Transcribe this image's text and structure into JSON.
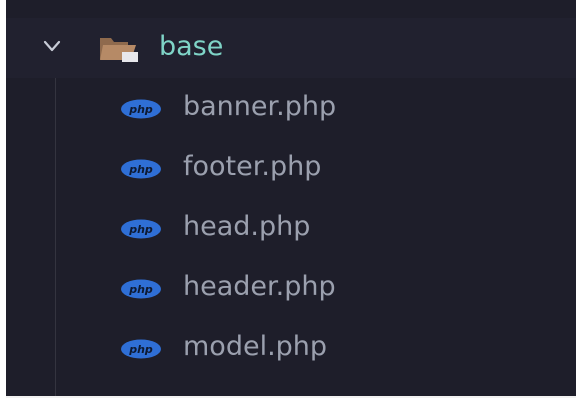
{
  "explorer": {
    "folder": {
      "label": "base",
      "expanded": true,
      "icon": "folder-open-icon",
      "chevron": "chevron-down-icon",
      "label_color": "#7fd4c7"
    },
    "files": [
      {
        "label": "banner.php",
        "icon": "php-icon"
      },
      {
        "label": "footer.php",
        "icon": "php-icon"
      },
      {
        "label": "head.php",
        "icon": "php-icon"
      },
      {
        "label": "header.php",
        "icon": "php-icon"
      },
      {
        "label": "model.php",
        "icon": "php-icon"
      }
    ],
    "colors": {
      "background": "#1e1e2a",
      "file_label": "#9ba0ae",
      "php_icon": "#2f6fd6"
    }
  }
}
